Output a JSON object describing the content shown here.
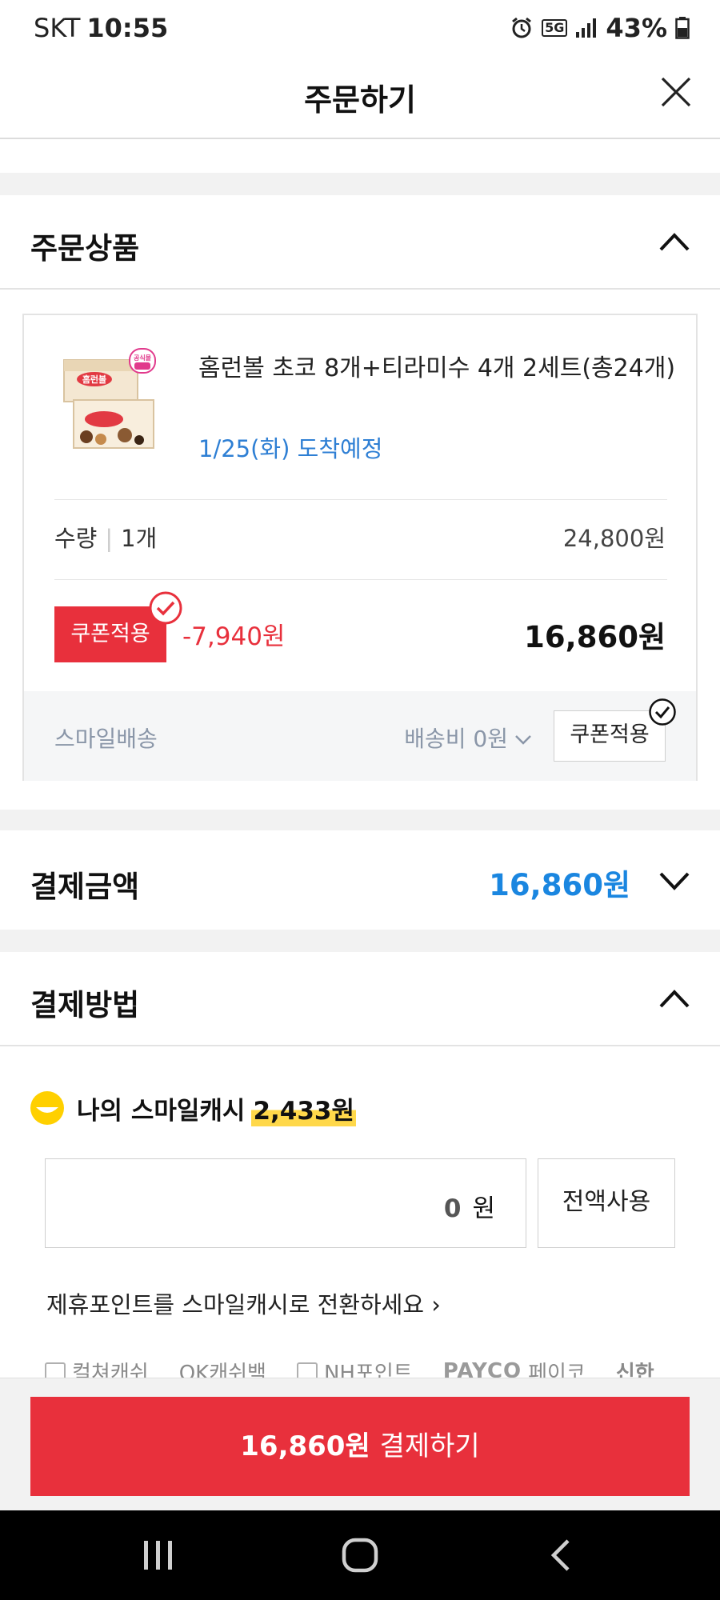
{
  "status_bar": {
    "carrier": "SKT",
    "time": "10:55",
    "network": "5G",
    "battery": "43%"
  },
  "header": {
    "title": "주문하기"
  },
  "order_items": {
    "section_title": "주문상품",
    "product": {
      "name": "홈런볼 초코 8개+티라미수 4개 2세트(총24개)",
      "arrival": "1/25(화) 도착예정",
      "image_badge": "공식몰",
      "image_label": "홈런볼"
    },
    "quantity_label": "수량",
    "quantity_value": "1개",
    "list_price": "24,800원",
    "coupon_tag": "쿠폰적용",
    "discount": "-7,940원",
    "final_price": "16,860원",
    "shipping": {
      "method": "스마일배송",
      "fee": "배송비 0원",
      "coupon_button": "쿠폰적용"
    }
  },
  "payment_amount": {
    "label": "결제금액",
    "amount": "16,860원"
  },
  "payment_method": {
    "section_title": "결제방법",
    "smile_cash_label": "나의 스마일캐시",
    "smile_cash_amount": "2,433원",
    "input_value": "0",
    "input_unit": "원",
    "use_all_button": "전액사용",
    "convert_link": "제휴포인트를 스마일캐시로 전환하세요 ›",
    "partners": [
      "컬쳐캐쉬",
      "OK캐쉬백",
      "NH포인트",
      "PAYCO",
      "페이코",
      "신한"
    ]
  },
  "pay_button": {
    "amount": "16,860원",
    "label": "결제하기"
  },
  "colors": {
    "accent_red": "#e8303c",
    "accent_blue": "#1a86e0",
    "arrival_blue": "#2e7fd4",
    "smile_yellow": "#ffd84a"
  }
}
